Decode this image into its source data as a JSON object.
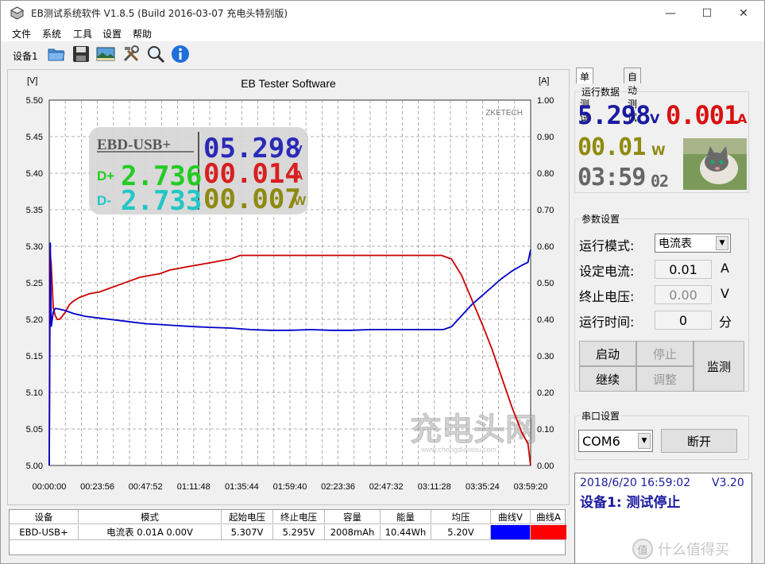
{
  "window": {
    "title": "EB测试系统软件 V1.8.5 (Build 2016-03-07 充电头特别版)",
    "min_glyph": "—",
    "max_glyph": "☐",
    "close_glyph": "✕"
  },
  "menu": [
    "文件",
    "系统",
    "工具",
    "设置",
    "帮助"
  ],
  "toolbar": {
    "device_label": "设备1",
    "icons": [
      "open-folder-icon",
      "save-icon",
      "image-icon",
      "tools-icon",
      "search-icon",
      "info-icon"
    ]
  },
  "chart": {
    "title": "EB Tester Software",
    "left_unit": "[V]",
    "right_unit": "[A]",
    "watermark": "ZKETECH",
    "overlay_watermark": "充电头网",
    "overlay_watermark_url": "www.chongdiantou.com",
    "inset": {
      "model": "EBD-USB+",
      "voltage": "05.298",
      "voltage_unit": "V",
      "current": "00.014",
      "current_unit": "A",
      "power": "00.007",
      "power_unit": "W",
      "dplus_label": "D+",
      "dplus": "2.736",
      "dminus_label": "D-",
      "dminus": "2.733"
    }
  },
  "chart_data": {
    "type": "line",
    "title": "EB Tester Software",
    "xlabel": "",
    "ylabel": "[V]",
    "y2label": "[A]",
    "x_ticks": [
      "00:00:00",
      "00:23:56",
      "00:47:52",
      "01:11:48",
      "01:35:44",
      "01:59:40",
      "02:23:36",
      "02:47:32",
      "03:11:28",
      "03:35:24",
      "03:59:20"
    ],
    "y_ticks": [
      "5.50",
      "5.45",
      "5.40",
      "5.35",
      "5.30",
      "5.25",
      "5.20",
      "5.15",
      "5.10",
      "5.05",
      "5.00"
    ],
    "y2_ticks": [
      "1.00",
      "0.90",
      "0.80",
      "0.70",
      "0.60",
      "0.50",
      "0.40",
      "0.30",
      "0.20",
      "0.10",
      "0.00"
    ],
    "ylim": [
      5.0,
      5.5
    ],
    "y2lim": [
      0.0,
      1.0
    ],
    "xlim_minutes": [
      0,
      239.33
    ],
    "grid": true,
    "series": [
      {
        "name": "曲线V",
        "axis": "left",
        "color": "#0000cc",
        "x_minutes": [
          0,
          0.5,
          1,
          2,
          3,
          5,
          8,
          12,
          18,
          24,
          30,
          36,
          42,
          48,
          54,
          60,
          66,
          72,
          80,
          90,
          100,
          110,
          120,
          130,
          140,
          150,
          160,
          170,
          180,
          190,
          196,
          200,
          205,
          210,
          215,
          220,
          225,
          230,
          235,
          238,
          239.3
        ],
        "values": [
          5.0,
          5.305,
          5.19,
          5.21,
          5.215,
          5.214,
          5.212,
          5.208,
          5.204,
          5.202,
          5.2,
          5.198,
          5.196,
          5.194,
          5.193,
          5.192,
          5.191,
          5.19,
          5.189,
          5.188,
          5.186,
          5.185,
          5.185,
          5.186,
          5.185,
          5.185,
          5.186,
          5.186,
          5.186,
          5.186,
          5.186,
          5.19,
          5.205,
          5.22,
          5.232,
          5.244,
          5.256,
          5.266,
          5.274,
          5.278,
          5.295
        ]
      },
      {
        "name": "曲线A",
        "axis": "right",
        "color": "#cc0000",
        "x_minutes": [
          0,
          0.3,
          1,
          2,
          3,
          4,
          5,
          6,
          8,
          10,
          12,
          15,
          20,
          25,
          30,
          35,
          40,
          45,
          50,
          55,
          60,
          70,
          80,
          90,
          95,
          100,
          110,
          120,
          140,
          160,
          180,
          195,
          200,
          205,
          210,
          215,
          220,
          225,
          230,
          235,
          238,
          239.3
        ],
        "values": [
          0.0,
          0.59,
          0.55,
          0.43,
          0.41,
          0.4,
          0.4,
          0.405,
          0.42,
          0.44,
          0.45,
          0.46,
          0.47,
          0.475,
          0.485,
          0.495,
          0.505,
          0.515,
          0.52,
          0.525,
          0.535,
          0.545,
          0.555,
          0.565,
          0.575,
          0.575,
          0.575,
          0.575,
          0.575,
          0.575,
          0.575,
          0.575,
          0.565,
          0.52,
          0.455,
          0.39,
          0.32,
          0.24,
          0.16,
          0.09,
          0.06,
          0.0
        ]
      }
    ]
  },
  "table": {
    "headers": [
      "设备",
      "模式",
      "起始电压",
      "终止电压",
      "容量",
      "能量",
      "均压",
      "曲线V",
      "曲线A"
    ],
    "rows": [
      [
        "EBD-USB+",
        "电流表  0.01A  0.00V",
        "5.307V",
        "5.295V",
        "2008mAh",
        "10.44Wh",
        "5.20V",
        "",
        ""
      ]
    ],
    "curve_v_color": "#0000ff",
    "curve_a_color": "#ff0000"
  },
  "right": {
    "tabs": [
      "单次测试",
      "自动测试"
    ],
    "run": {
      "title": "运行数据",
      "voltage": "5.298",
      "voltage_unit": "V",
      "current": "0.001",
      "current_unit": "A",
      "power": "00.01",
      "power_unit": "W",
      "time_main": "03:59",
      "time_sec": "02"
    },
    "params": {
      "title": "参数设置",
      "mode_label": "运行模式:",
      "mode_value": "电流表",
      "current_label": "设定电流:",
      "current_value": "0.01",
      "current_unit": "A",
      "stopv_label": "终止电压:",
      "stopv_value": "0.00",
      "stopv_unit": "V",
      "time_label": "运行时间:",
      "time_value": "0",
      "time_unit": "分",
      "btn_start": "启动",
      "btn_stop": "停止",
      "btn_monitor": "监测",
      "btn_continue": "继续",
      "btn_adjust": "调整"
    },
    "serial": {
      "title": "串口设置",
      "port": "COM6",
      "btn_disconnect": "断开"
    },
    "status": {
      "datetime": "2018/6/20 16:59:02",
      "version": "V3.20",
      "message": "设备1: 测试停止"
    }
  },
  "watermark": {
    "text": "值 什么值得买"
  },
  "colors": {
    "voltage_blue": "#1a1aa0",
    "current_red": "#d81010",
    "power_olive": "#8f8a10",
    "time_gray": "#666666",
    "dplus_green": "#22cc22",
    "dminus_cyan": "#22c6c6"
  }
}
